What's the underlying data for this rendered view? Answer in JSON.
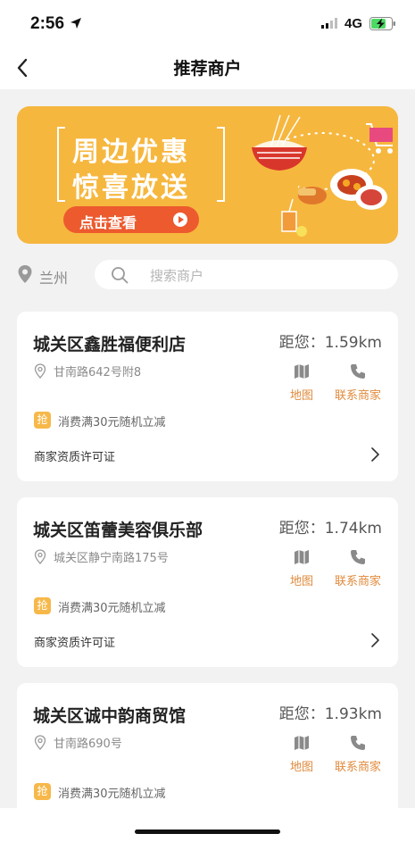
{
  "status_bar": {
    "time": "2:56",
    "network": "4G"
  },
  "nav": {
    "title": "推荐商户"
  },
  "banner": {
    "line1": "周边优惠",
    "line2": "惊喜放送",
    "cta": "点击查看"
  },
  "location": {
    "city": "兰州"
  },
  "search": {
    "placeholder": "搜索商户"
  },
  "merchants": [
    {
      "name": "城关区鑫胜福便利店",
      "distance": "距您：1.59km",
      "address": "甘南路642号附8",
      "map_label": "地图",
      "contact_label": "联系商家",
      "promo_badge": "抢",
      "promo": "消费满30元随机立减",
      "license": "商家资质许可证"
    },
    {
      "name": "城关区笛蕾美容俱乐部",
      "distance": "距您：1.74km",
      "address": "城关区静宁南路175号",
      "map_label": "地图",
      "contact_label": "联系商家",
      "promo_badge": "抢",
      "promo": "消费满30元随机立减",
      "license": "商家资质许可证"
    },
    {
      "name": "城关区诚中韵商贸馆",
      "distance": "距您：1.93km",
      "address": "甘南路690号",
      "map_label": "地图",
      "contact_label": "联系商家",
      "promo_badge": "抢",
      "promo": "消费满30元随机立减"
    }
  ],
  "colors": {
    "banner_bg": "#f6b73f",
    "cta_bg": "#ec5a2e",
    "accent_orange": "#e08a3c",
    "page_bg": "#f2f2f2"
  }
}
